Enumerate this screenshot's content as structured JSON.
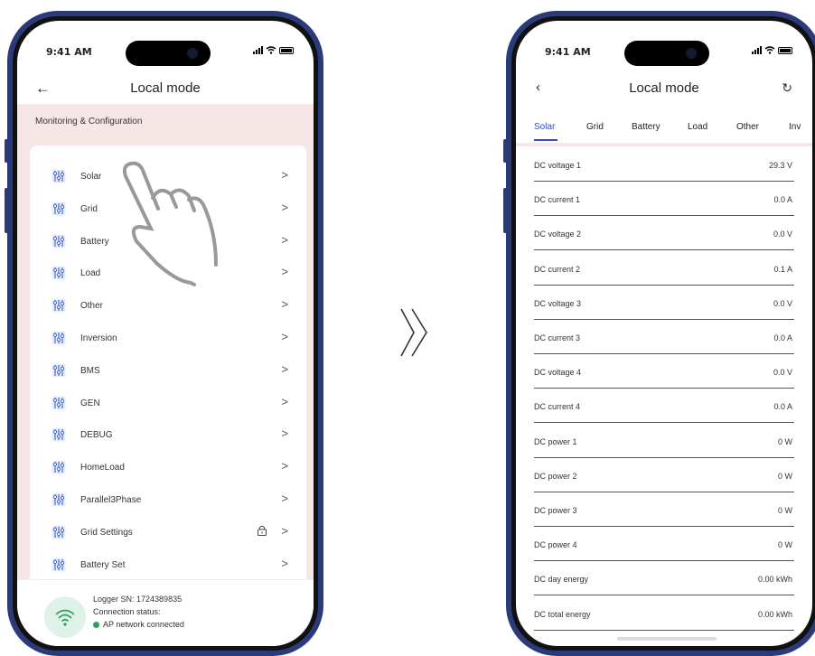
{
  "status_bar": {
    "time": "9:41 AM"
  },
  "left_screen": {
    "header": {
      "title": "Local mode"
    },
    "section_label": "Monitoring & Configuration",
    "menu_items": [
      {
        "label": "Solar",
        "locked": false
      },
      {
        "label": "Grid",
        "locked": false
      },
      {
        "label": "Battery",
        "locked": false
      },
      {
        "label": "Load",
        "locked": false
      },
      {
        "label": "Other",
        "locked": false
      },
      {
        "label": "Inversion",
        "locked": false
      },
      {
        "label": "BMS",
        "locked": false
      },
      {
        "label": "GEN",
        "locked": false
      },
      {
        "label": "DEBUG",
        "locked": false
      },
      {
        "label": "HomeLoad",
        "locked": false
      },
      {
        "label": "Parallel3Phase",
        "locked": false
      },
      {
        "label": "Grid Settings",
        "locked": true
      },
      {
        "label": "Battery Set",
        "locked": false
      }
    ],
    "footer": {
      "logger_sn": "Logger SN: 1724389835",
      "connection_label": "Connection status:",
      "connection_value": "AP network connected"
    }
  },
  "right_screen": {
    "header": {
      "title": "Local mode"
    },
    "tabs": [
      "Solar",
      "Grid",
      "Battery",
      "Load",
      "Other",
      "Inv"
    ],
    "active_tab": "Solar",
    "rows": [
      {
        "label": "DC voltage 1",
        "value": "29.3 V"
      },
      {
        "label": "DC current 1",
        "value": "0.0 A"
      },
      {
        "label": "DC voltage 2",
        "value": "0.0 V"
      },
      {
        "label": "DC current 2",
        "value": "0.1 A"
      },
      {
        "label": "DC voltage 3",
        "value": "0.0 V"
      },
      {
        "label": "DC current 3",
        "value": "0.0 A"
      },
      {
        "label": "DC voltage 4",
        "value": "0.0 V"
      },
      {
        "label": "DC current 4",
        "value": "0.0 A"
      },
      {
        "label": "DC power 1",
        "value": "0 W"
      },
      {
        "label": "DC power 2",
        "value": "0 W"
      },
      {
        "label": "DC power 3",
        "value": "0 W"
      },
      {
        "label": "DC power 4",
        "value": "0 W"
      },
      {
        "label": "DC day energy",
        "value": "0.00 kWh"
      },
      {
        "label": "DC total energy",
        "value": "0.00 kWh"
      }
    ]
  },
  "colors": {
    "accent": "#3c4cb4",
    "pink_bg": "#f7e6e6",
    "phone_frame": "#2b3a7a",
    "connected": "#2aa05a",
    "icon_blue": "#4a6ad0"
  },
  "icons": {
    "menu_item_icon": "sliders-icon",
    "lock": "lock-icon",
    "chevron": "chevron-right-icon",
    "back": "arrow-left-icon",
    "refresh": "refresh-icon",
    "wifi": "wifi-icon",
    "gesture": "tap-hand-icon"
  }
}
